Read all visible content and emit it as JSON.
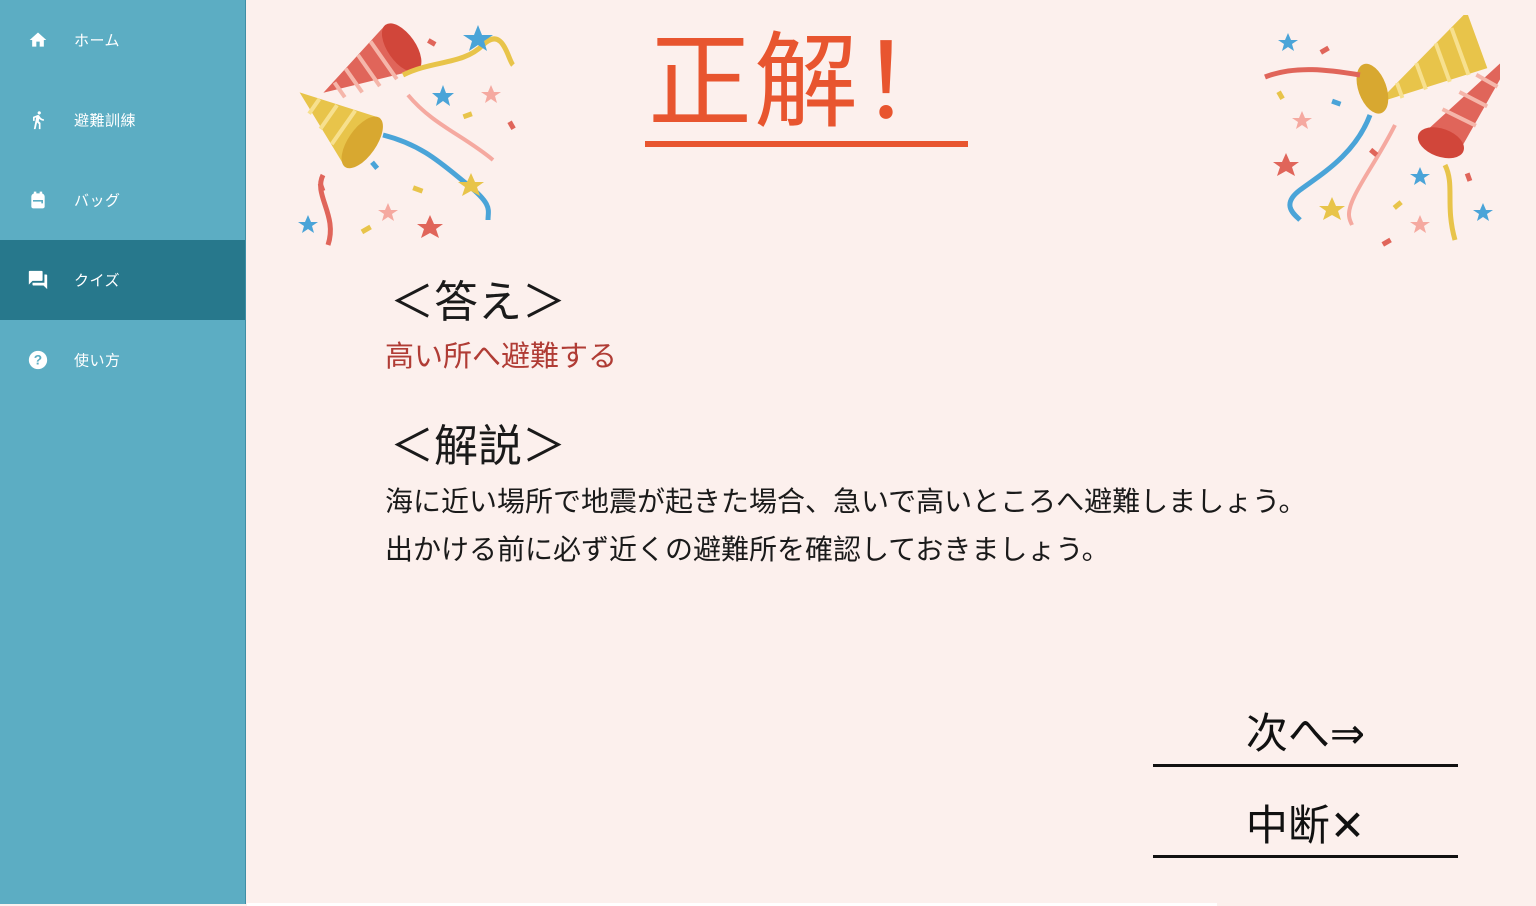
{
  "sidebar": {
    "items": [
      {
        "label": "ホーム",
        "icon": "home-icon",
        "active": false
      },
      {
        "label": "避難訓練",
        "icon": "running-person-icon",
        "active": false
      },
      {
        "label": "バッグ",
        "icon": "backpack-icon",
        "active": false
      },
      {
        "label": "クイズ",
        "icon": "chat-bubbles-icon",
        "active": true
      },
      {
        "label": "使い方",
        "icon": "help-circle-icon",
        "active": false
      }
    ]
  },
  "main": {
    "title": "正解！",
    "answer_heading": "＜答え＞",
    "answer_text": "高い所へ避難する",
    "explanation_heading": "＜解説＞",
    "explanation_line1": "海に近い場所で地震が起きた場合、急いで高いところへ避難しましょう。",
    "explanation_line2": "出かける前に必ず近くの避難所を確認しておきましょう。",
    "next_button": "次へ⇒",
    "stop_button": "中断✕"
  },
  "colors": {
    "sidebar": "#5cadc3",
    "sidebar_active": "#27788c",
    "background": "#fcf0ed",
    "title": "#e8552f",
    "answer": "#b03c35"
  }
}
